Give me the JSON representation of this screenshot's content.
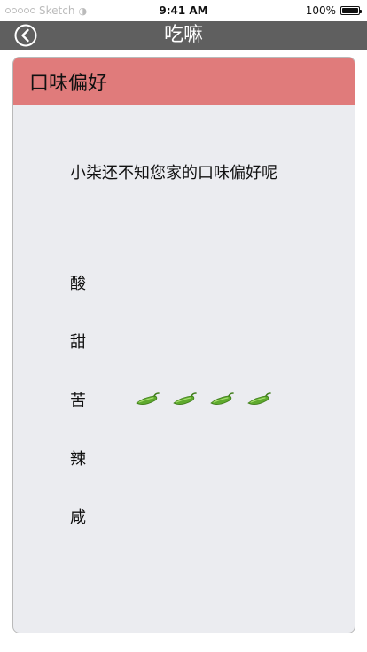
{
  "status_bar": {
    "carrier": "Sketch",
    "time": "9:41 AM",
    "battery": "100%"
  },
  "navbar": {
    "title": "吃嘛",
    "back_icon": "back-arrow-circle-icon"
  },
  "card": {
    "header": "口味偏好",
    "prompt": "小柒还不知您家的口味偏好呢",
    "tastes": [
      {
        "label": "酸",
        "peppers": 0
      },
      {
        "label": "甜",
        "peppers": 0
      },
      {
        "label": "苦",
        "peppers": 4
      },
      {
        "label": "辣",
        "peppers": 0
      },
      {
        "label": "咸",
        "peppers": 0
      }
    ],
    "pepper_icon": "green-pepper-icon",
    "colors": {
      "header": "#e07b7b",
      "navbar": "#5f5f5f",
      "card_bg": "#ebecf0"
    }
  }
}
